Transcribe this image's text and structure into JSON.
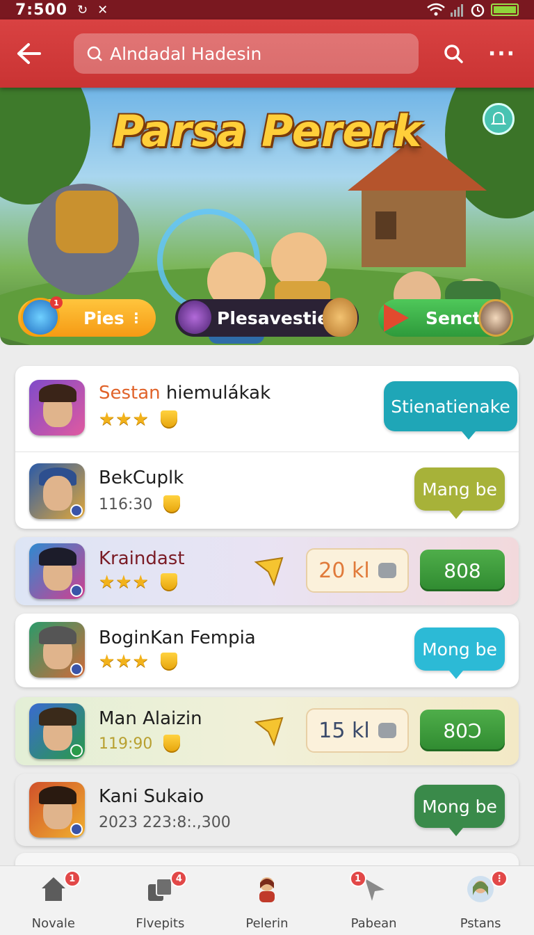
{
  "status_bar": {
    "time": "7:500",
    "icon_left_1": "sync-icon",
    "icon_left_2": "bluetooth-icon"
  },
  "app_bar": {
    "search_text": "Alndadal Hadesin"
  },
  "banner": {
    "title": "Parsa Pererk",
    "pills": [
      {
        "label": "Pies",
        "badge": "1"
      },
      {
        "label": "Plesavesties"
      },
      {
        "label": "Senct"
      }
    ]
  },
  "rows": [
    {
      "name": "Sestan hiemulákak",
      "name_highlight": "Sestan",
      "name_rest": " hiemulákak",
      "rating": "★★★",
      "action": "Stienatienake"
    },
    {
      "name": "BekCuplk",
      "time": "116:30",
      "action": "Mang be"
    },
    {
      "name": "Kraindast",
      "rating": "★★★",
      "price": "20 kl",
      "button": "808"
    },
    {
      "name": "BoginKan Fempia",
      "rating": "★★★",
      "action": "Mong be"
    },
    {
      "name": "Man Alaizin",
      "time": "119:90",
      "price": "15 kl",
      "button": "80Ɔ"
    },
    {
      "name": "Kani Sukaio",
      "time": "2023 223:8:.,300",
      "action": "Mong be"
    }
  ],
  "bottom_nav": [
    {
      "label": "Novale",
      "badge": "1",
      "icon": "home-icon"
    },
    {
      "label": "Flvepits",
      "badge": "4",
      "icon": "cards-icon"
    },
    {
      "label": "Pelerin",
      "badge": "",
      "icon": "character-icon"
    },
    {
      "label": "Pabean",
      "badge": "1",
      "icon": "cursor-icon"
    },
    {
      "label": "Pstans",
      "badge": "",
      "icon": "profile-icon"
    }
  ],
  "colors": {
    "app_bar": "#d33b3b",
    "teal_bubble": "#22a7b8",
    "olive_bubble": "#a9b23a",
    "cyan_bubble": "#2cb9d6",
    "green_bubble": "#3a8a4a",
    "green_button": "#3a9a3a"
  }
}
